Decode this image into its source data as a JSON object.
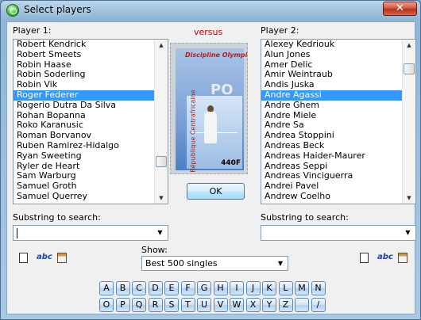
{
  "window": {
    "title": "Select players",
    "close_label": "✕"
  },
  "player1": {
    "label": "Player 1:",
    "items": [
      "Robert Kendrick",
      "Robert Smeets",
      "Robin Haase",
      "Robin Soderling",
      "Robin Vik",
      "Roger Federer",
      "Rogerio Dutra Da Silva",
      "Rohan Bopanna",
      "Roko Karanusic",
      "Roman Borvanov",
      "Ruben Ramirez-Hidalgo",
      "Ryan Sweeting",
      "Ryler de Heart",
      "Sam Warburg",
      "Samuel Groth",
      "Samuel Querrey"
    ],
    "selected": "Roger Federer",
    "search_label": "Substring to search:",
    "search_value": ""
  },
  "player2": {
    "label": "Player 2:",
    "items": [
      "Alexey Kedriouk",
      "Alun Jones",
      "Amer Delic",
      "Amir Weintraub",
      "Andis Juska",
      "Andre Agassi",
      "Andre Ghem",
      "Andre Miele",
      "Andre Sa",
      "Andrea Stoppini",
      "Andreas Beck",
      "Andreas Haider-Maurer",
      "Andreas Seppi",
      "Andreas Vinciguerra",
      "Andrei Pavel",
      "Andrew Coelho"
    ],
    "selected": "Andre Agassi",
    "search_label": "Substring to search:",
    "search_value": ""
  },
  "center": {
    "versus": "versus",
    "ok_label": "OK",
    "stamp": {
      "top_text": "Discipline Olympique",
      "side_text": "République Centrafricaine",
      "value": "440F",
      "watermark": "PO"
    },
    "versus_color": "#c00000"
  },
  "show": {
    "label": "Show:",
    "selected": "Best 500 singles"
  },
  "icons": {
    "new": "document-icon",
    "abc": "abc",
    "paste": "clipboard-icon"
  },
  "keyboard": {
    "row1": [
      "A",
      "B",
      "C",
      "D",
      "E",
      "F",
      "G",
      "H",
      "I",
      "J",
      "K",
      "L",
      "M",
      "N"
    ],
    "row2": [
      "O",
      "P",
      "Q",
      "R",
      "S",
      "T",
      "U",
      "V",
      "W",
      "X",
      "Y",
      "Z",
      " ",
      "/"
    ]
  }
}
